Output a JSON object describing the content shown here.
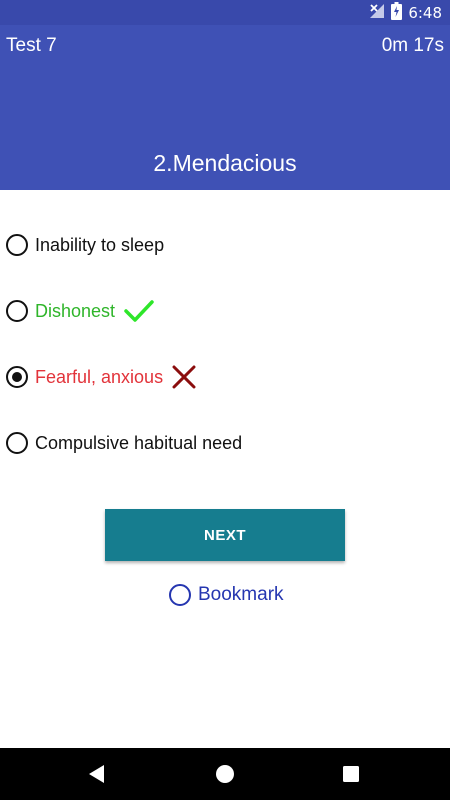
{
  "status_bar": {
    "time": "6:48",
    "signal_icon": "signal-off-icon",
    "battery_icon": "battery-charging-icon"
  },
  "header": {
    "test_name": "Test 7",
    "timer": "0m 17s",
    "question": "2.Mendacious"
  },
  "options": [
    {
      "label": "Inability to sleep",
      "selected": false,
      "state": "none"
    },
    {
      "label": "Dishonest",
      "selected": false,
      "state": "correct",
      "icon": "check-icon"
    },
    {
      "label": "Fearful, anxious",
      "selected": true,
      "state": "wrong",
      "icon": "cross-icon"
    },
    {
      "label": "Compulsive habitual need",
      "selected": false,
      "state": "none"
    }
  ],
  "next_label": "NEXT",
  "bookmark_label": "Bookmark",
  "colors": {
    "header": "#3f51b5",
    "correct": "#2fb52a",
    "wrong": "#e2333a",
    "next_button": "#167d8f",
    "bookmark": "#2536b0"
  },
  "nav": {
    "back_icon": "back-triangle-icon",
    "home_icon": "home-circle-icon",
    "recents_icon": "recents-square-icon"
  }
}
